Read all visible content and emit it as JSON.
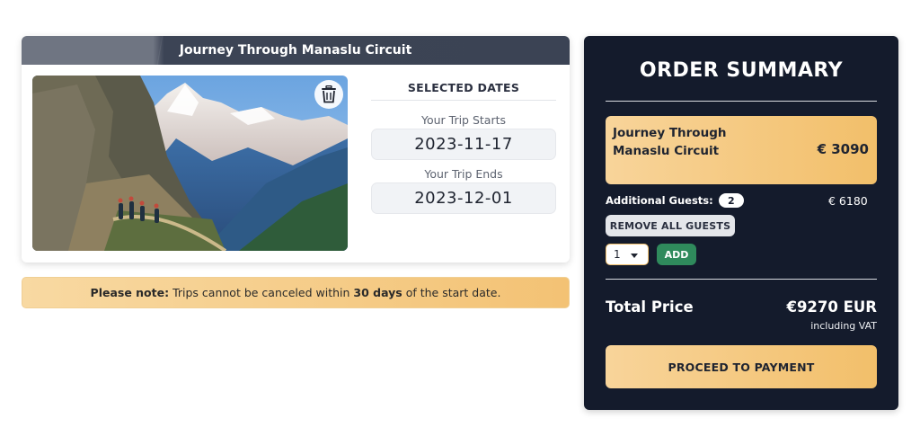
{
  "trip": {
    "title": "Journey Through Manaslu Circuit",
    "image_alt": "Hikers on a mountain trail with snowy peaks",
    "dates": {
      "heading": "SELECTED DATES",
      "start_label": "Your Trip Starts",
      "start_value": "2023-11-17",
      "end_label": "Your Trip Ends",
      "end_value": "2023-12-01"
    }
  },
  "note": {
    "prefix": "Please note:",
    "text_before": " Trips cannot be canceled within ",
    "emphasis": "30 days",
    "text_after": " of the start date."
  },
  "summary": {
    "title": "ORDER SUMMARY",
    "item": {
      "name": "Journey Through Manaslu Circuit",
      "price": "€ 3090"
    },
    "guests": {
      "label": "Additional Guests:",
      "count": "2",
      "price": "€ 6180",
      "remove_label": "REMOVE ALL GUESTS",
      "quantity_selected": "1",
      "add_label": "ADD"
    },
    "total": {
      "label": "Total Price",
      "value": "€9270 EUR",
      "vat_note": "including VAT"
    },
    "pay_label": "PROCEED TO PAYMENT"
  },
  "icons": {
    "delete": "trash-icon",
    "dropdown": "chevron-down-icon"
  },
  "colors": {
    "panel_dark": "#141b2c",
    "accent_gold": "#f2bf6a",
    "add_green": "#2f8a5c",
    "header_slate": "#3b4354"
  }
}
